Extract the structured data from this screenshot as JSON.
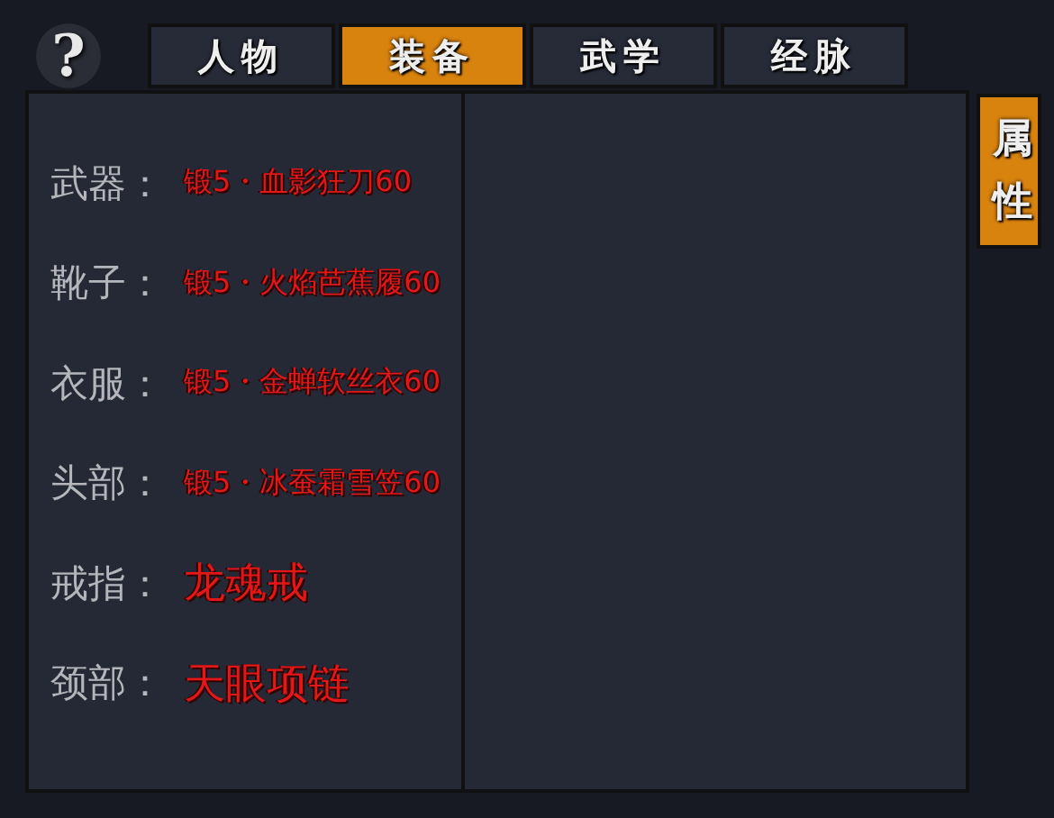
{
  "help_button": "?",
  "tabs": [
    {
      "label": "人物",
      "selected": false
    },
    {
      "label": "装备",
      "selected": true
    },
    {
      "label": "武学",
      "selected": false
    },
    {
      "label": "经脉",
      "selected": false
    }
  ],
  "equipment": [
    {
      "slot": "武器：",
      "item": "锻5・血影狂刀60",
      "kind": "forged"
    },
    {
      "slot": "靴子：",
      "item": "锻5・火焰芭蕉履60",
      "kind": "forged"
    },
    {
      "slot": "衣服：",
      "item": "锻5・金蝉软丝衣60",
      "kind": "forged"
    },
    {
      "slot": "头部：",
      "item": "锻5・冰蚕霜雪笠60",
      "kind": "forged"
    },
    {
      "slot": "戒指：",
      "item": "龙魂戒",
      "kind": "plain"
    },
    {
      "slot": "颈部：",
      "item": "天眼项链",
      "kind": "plain"
    }
  ],
  "side_tabs": [
    {
      "label": "属性",
      "selected": true
    }
  ]
}
